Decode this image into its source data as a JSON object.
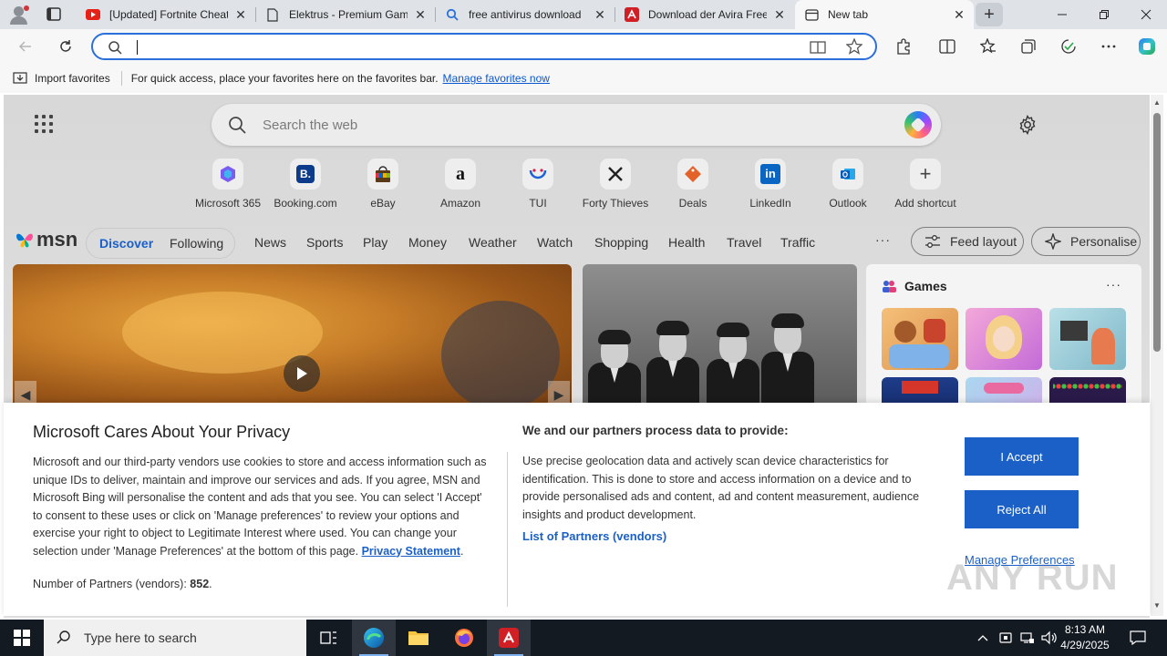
{
  "browser": {
    "tabs": [
      {
        "title": "[Updated] Fortnite Cheat",
        "favicon": "youtube-icon",
        "active": false
      },
      {
        "title": "Elektrus - Premium Gam",
        "favicon": "page-icon",
        "active": false
      },
      {
        "title": "free antivirus download",
        "favicon": "search-icon",
        "active": false
      },
      {
        "title": "Download der Avira Free",
        "favicon": "avira-icon",
        "active": false
      },
      {
        "title": "New tab",
        "favicon": "newtab-icon",
        "active": true
      }
    ],
    "address_value": "",
    "favorites_bar": {
      "import_label": "Import favorites",
      "message": "For quick access, place your favorites here on the favorites bar.",
      "manage_link": "Manage favorites now"
    }
  },
  "ntp": {
    "search_placeholder": "Search the web",
    "shortcuts": [
      {
        "label": "Microsoft 365",
        "icon": "microsoft365-icon"
      },
      {
        "label": "Booking.com",
        "icon": "booking-icon"
      },
      {
        "label": "eBay",
        "icon": "ebay-icon"
      },
      {
        "label": "Amazon",
        "icon": "amazon-icon"
      },
      {
        "label": "TUI",
        "icon": "tui-icon"
      },
      {
        "label": "Forty Thieves",
        "icon": "forty-thieves-icon"
      },
      {
        "label": "Deals",
        "icon": "deals-icon"
      },
      {
        "label": "LinkedIn",
        "icon": "linkedin-icon"
      },
      {
        "label": "Outlook",
        "icon": "outlook-icon"
      },
      {
        "label": "Add shortcut",
        "icon": "plus-icon"
      }
    ],
    "msn_logo": "msn",
    "feed_tabs": {
      "discover": "Discover",
      "following": "Following"
    },
    "nav": [
      "News",
      "Sports",
      "Play",
      "Money",
      "Weather",
      "Watch",
      "Shopping",
      "Health",
      "Travel",
      "Traffic"
    ],
    "nav_more": "···",
    "feed_layout_label": "Feed layout",
    "personalise_label": "Personalise",
    "games_title": "Games",
    "games_more": "···"
  },
  "privacy": {
    "title": "Microsoft Cares About Your Privacy",
    "body": "Microsoft and our third-party vendors use cookies to store and access information such as unique IDs to deliver, maintain and improve our services and ads. If you agree, MSN and Microsoft Bing will personalise the content and ads that you see. You can select 'I Accept' to consent to these uses or click on 'Manage preferences' to review your options and exercise your right to object to Legitimate Interest where used.  You can change your selection under 'Manage Preferences' at the bottom of this page.",
    "privacy_link": "Privacy Statement",
    "partners_label": "Number of Partners (vendors):",
    "partners_count": "852",
    "purposes_title": "We and our partners process data to provide:",
    "purposes_text": "Use precise geolocation data and actively scan device characteristics for identification. This is done to store and access information on a device and to provide personalised ads and content, ad and content measurement, audience insights and product development.",
    "list_link": "List of Partners (vendors)",
    "accept": "I Accept",
    "reject": "Reject All",
    "manage": "Manage Preferences"
  },
  "watermark": "ANY RUN",
  "taskbar": {
    "search_placeholder": "Type here to search",
    "time": "8:13 AM",
    "date": "4/29/2025"
  },
  "colors": {
    "accent": "#1b60c7",
    "address_border": "#2a6fdb",
    "taskbar": "#141a22"
  }
}
